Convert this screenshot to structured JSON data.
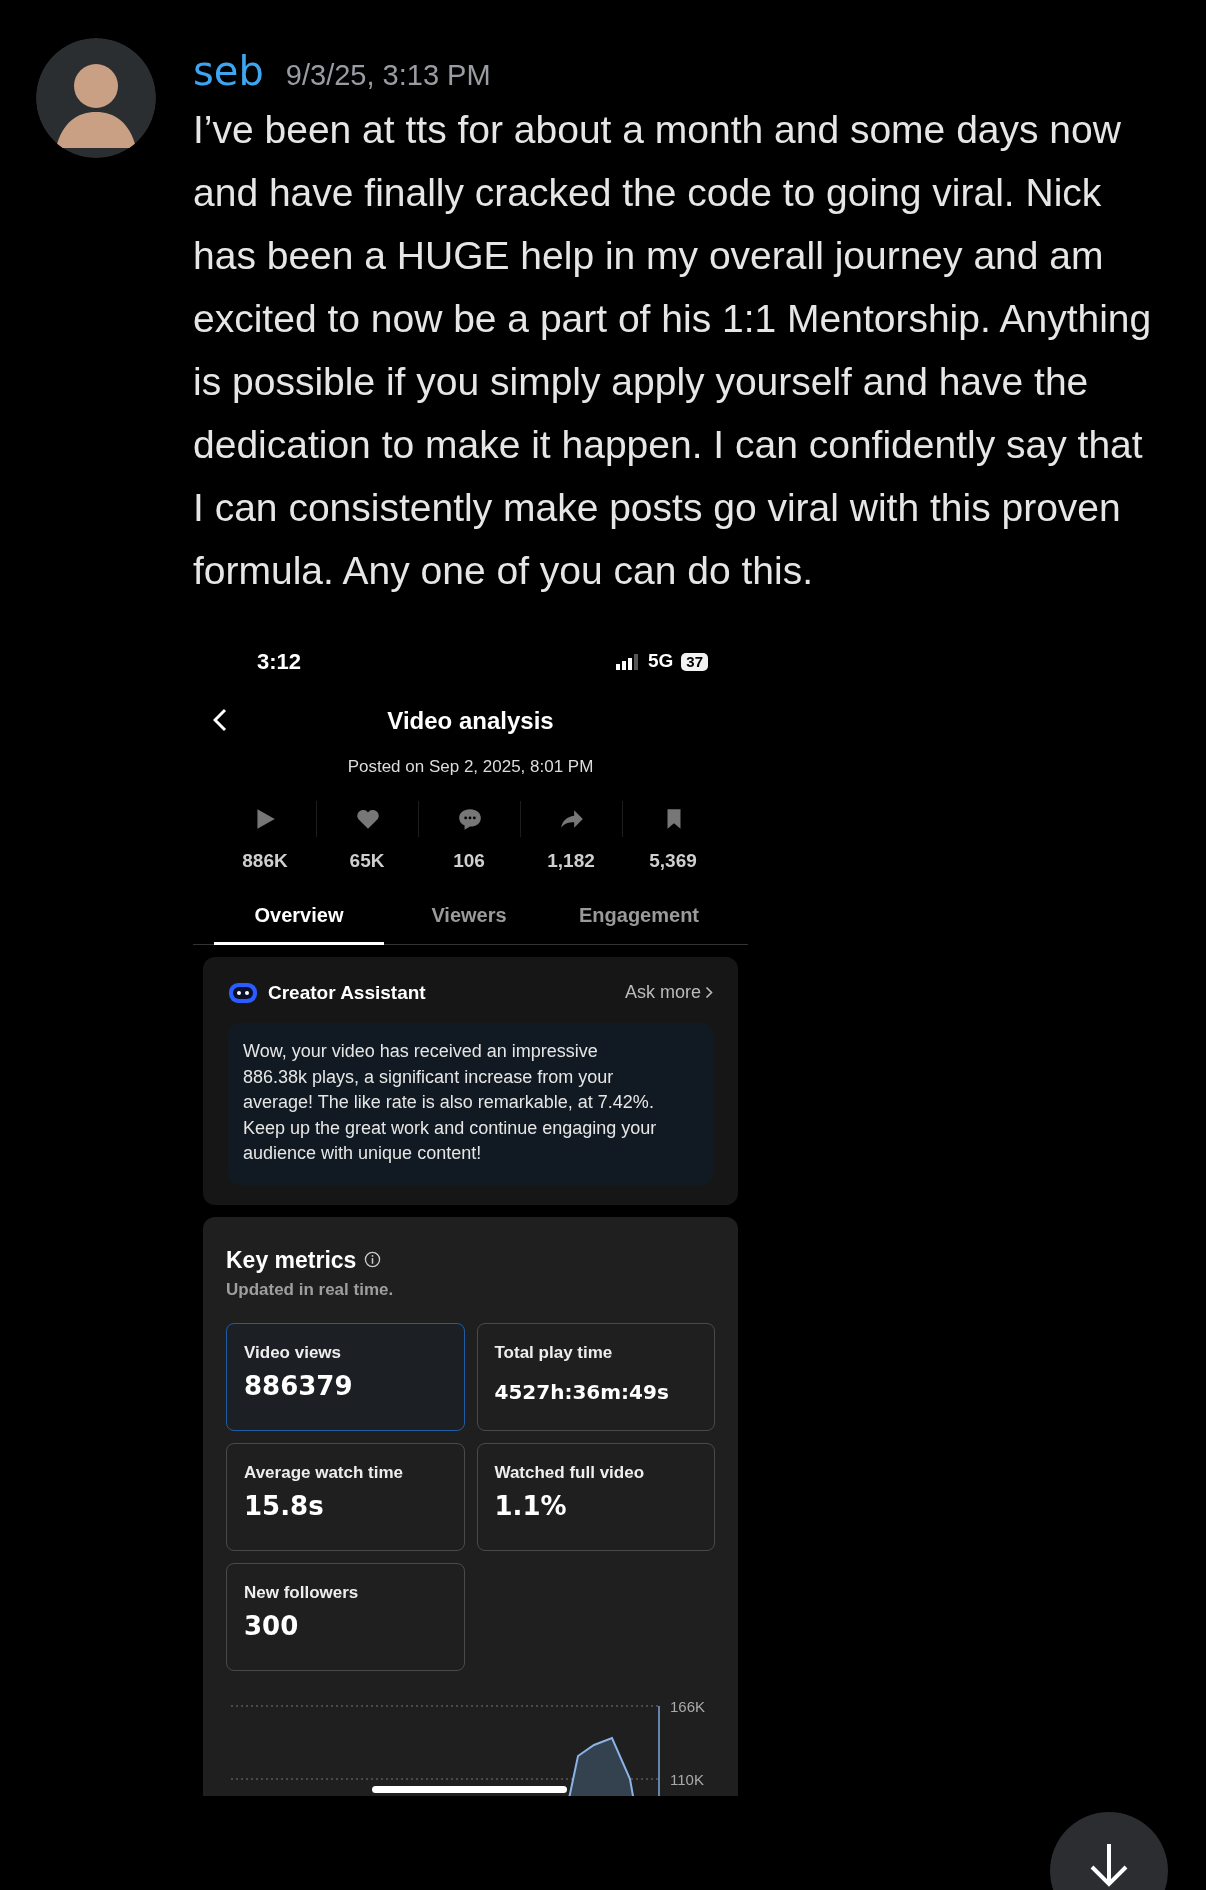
{
  "message": {
    "author": "seb",
    "timestamp": "9/3/25, 3:13 PM",
    "text": "I’ve been at tts for about a month and some days now and have finally cracked the code to going viral. Nick has been a HUGE help in my overall journey and am excited to now be a part of his 1:1 Mentorship. Anything is possible if you simply apply yourself and have the dedication to make it happen. I can confidently say that I can consistently make posts go viral with this proven formula. Any one of you can do this."
  },
  "attachment": {
    "status_bar": {
      "time": "3:12",
      "network": "5G",
      "battery": "37"
    },
    "header": {
      "title": "Video analysis",
      "posted": "Posted on Sep 2, 2025, 8:01 PM"
    },
    "stats": [
      {
        "kind": "play",
        "value": "886K"
      },
      {
        "kind": "like",
        "value": "65K"
      },
      {
        "kind": "comment",
        "value": "106"
      },
      {
        "kind": "share",
        "value": "1,182"
      },
      {
        "kind": "bookmark",
        "value": "5,369"
      }
    ],
    "tabs": [
      {
        "label": "Overview",
        "selected": true
      },
      {
        "label": "Viewers",
        "selected": false
      },
      {
        "label": "Engagement",
        "selected": false
      }
    ],
    "assistant": {
      "title": "Creator Assistant",
      "link": "Ask more",
      "text": "Wow, your video has received an impressive 886.38k plays, a significant increase from your average! The like rate is also remarkable, at 7.42%. Keep up the great work and continue engaging your audience with unique content!"
    },
    "key_metrics": {
      "title": "Key metrics",
      "subtitle": "Updated in real time.",
      "tiles": [
        {
          "label": "Video views",
          "value": "886379",
          "selected": true
        },
        {
          "label": "Total play time",
          "value": "4527h:36m:49s",
          "selected": false
        },
        {
          "label": "Average watch time",
          "value": "15.8s",
          "selected": false
        },
        {
          "label": "Watched full video",
          "value": "1.1%",
          "selected": false
        },
        {
          "label": "New followers",
          "value": "300",
          "selected": false
        }
      ]
    },
    "chart": {
      "y_tick_labels": [
        "166K",
        "110K"
      ]
    }
  }
}
